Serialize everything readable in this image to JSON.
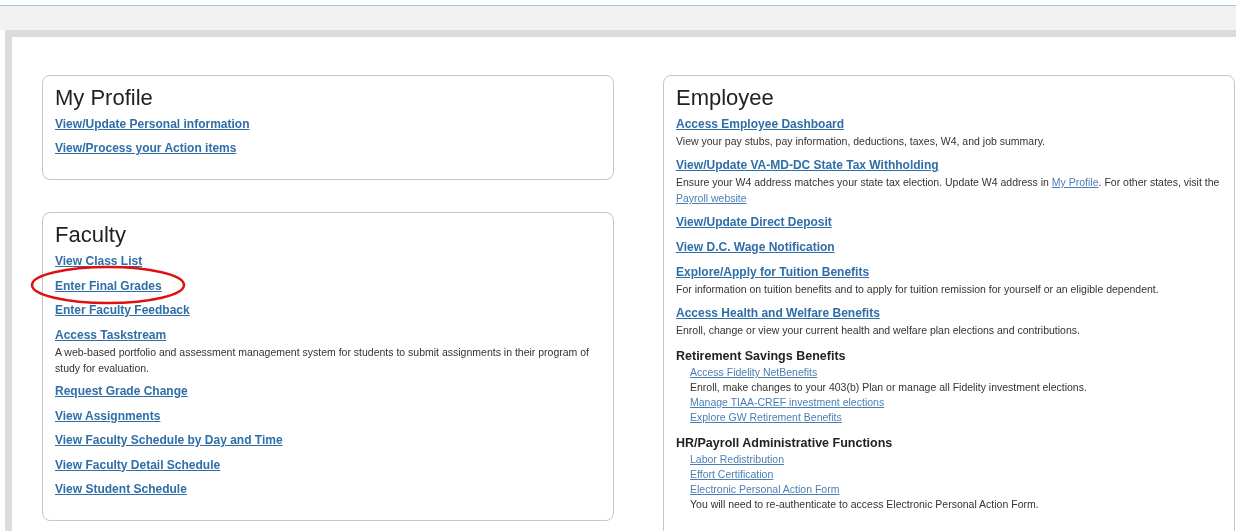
{
  "profile": {
    "title": "My Profile",
    "links": [
      "View/Update Personal information",
      "View/Process your Action items"
    ]
  },
  "faculty": {
    "title": "Faculty",
    "items": [
      {
        "text": "View Class List",
        "circled": false
      },
      {
        "text": "Enter Final Grades",
        "circled": true
      },
      {
        "text": "Enter Faculty Feedback",
        "circled": false
      },
      {
        "text": "Access Taskstream",
        "circled": false,
        "description": "A web-based portfolio and assessment management system for students to submit assignments in their program of study for evaluation."
      },
      {
        "text": "Request Grade Change",
        "circled": false
      },
      {
        "text": "View Assignments",
        "circled": false
      },
      {
        "text": "View Faculty Schedule by Day and Time",
        "circled": false
      },
      {
        "text": "View Faculty Detail Schedule",
        "circled": false
      },
      {
        "text": "View Student Schedule",
        "circled": false
      }
    ]
  },
  "employee": {
    "title": "Employee",
    "items": [
      {
        "kind": "link",
        "text": "Access Employee Dashboard",
        "description": [
          {
            "kind": "text",
            "text": "View your pay stubs, pay information, deductions, taxes, W4, and job summary."
          }
        ]
      },
      {
        "kind": "link",
        "text": "View/Update VA-MD-DC State Tax Withholding",
        "description": [
          {
            "kind": "text",
            "text": "Ensure your W4 address matches your state tax election. Update W4 address in "
          },
          {
            "kind": "link",
            "text": "My Profile"
          },
          {
            "kind": "text",
            "text": ". For other states, visit the "
          },
          {
            "kind": "link",
            "text": "Payroll website"
          }
        ]
      },
      {
        "kind": "link",
        "text": "View/Update Direct Deposit"
      },
      {
        "kind": "link",
        "text": "View D.C. Wage Notification"
      },
      {
        "kind": "link",
        "text": "Explore/Apply for Tuition Benefits",
        "description": [
          {
            "kind": "text",
            "text": "For information on tuition benefits and to apply for tuition remission for yourself or an eligible dependent."
          }
        ]
      },
      {
        "kind": "link",
        "text": "Access Health and Welfare Benefits",
        "description": [
          {
            "kind": "text",
            "text": "Enroll, change or view your current health and welfare plan elections and contributions."
          }
        ]
      },
      {
        "kind": "section",
        "heading": "Retirement Savings Benefits",
        "entries": [
          {
            "kind": "link",
            "text": "Access Fidelity NetBenefits"
          },
          {
            "kind": "note",
            "text": "Enroll, make changes to your 403(b) Plan or manage all Fidelity investment elections."
          },
          {
            "kind": "link",
            "text": "Manage TIAA-CREF investment elections"
          },
          {
            "kind": "link",
            "text": "Explore GW Retirement Benefits"
          }
        ]
      },
      {
        "kind": "section",
        "heading": "HR/Payroll Administrative Functions",
        "entries": [
          {
            "kind": "link",
            "text": "Labor Redistribution"
          },
          {
            "kind": "link",
            "text": "Effort Certification"
          },
          {
            "kind": "link",
            "text": "Electronic Personal Action Form"
          },
          {
            "kind": "note",
            "text": "You will need to re-authenticate to access Electronic Personal Action Form."
          }
        ]
      }
    ]
  }
}
